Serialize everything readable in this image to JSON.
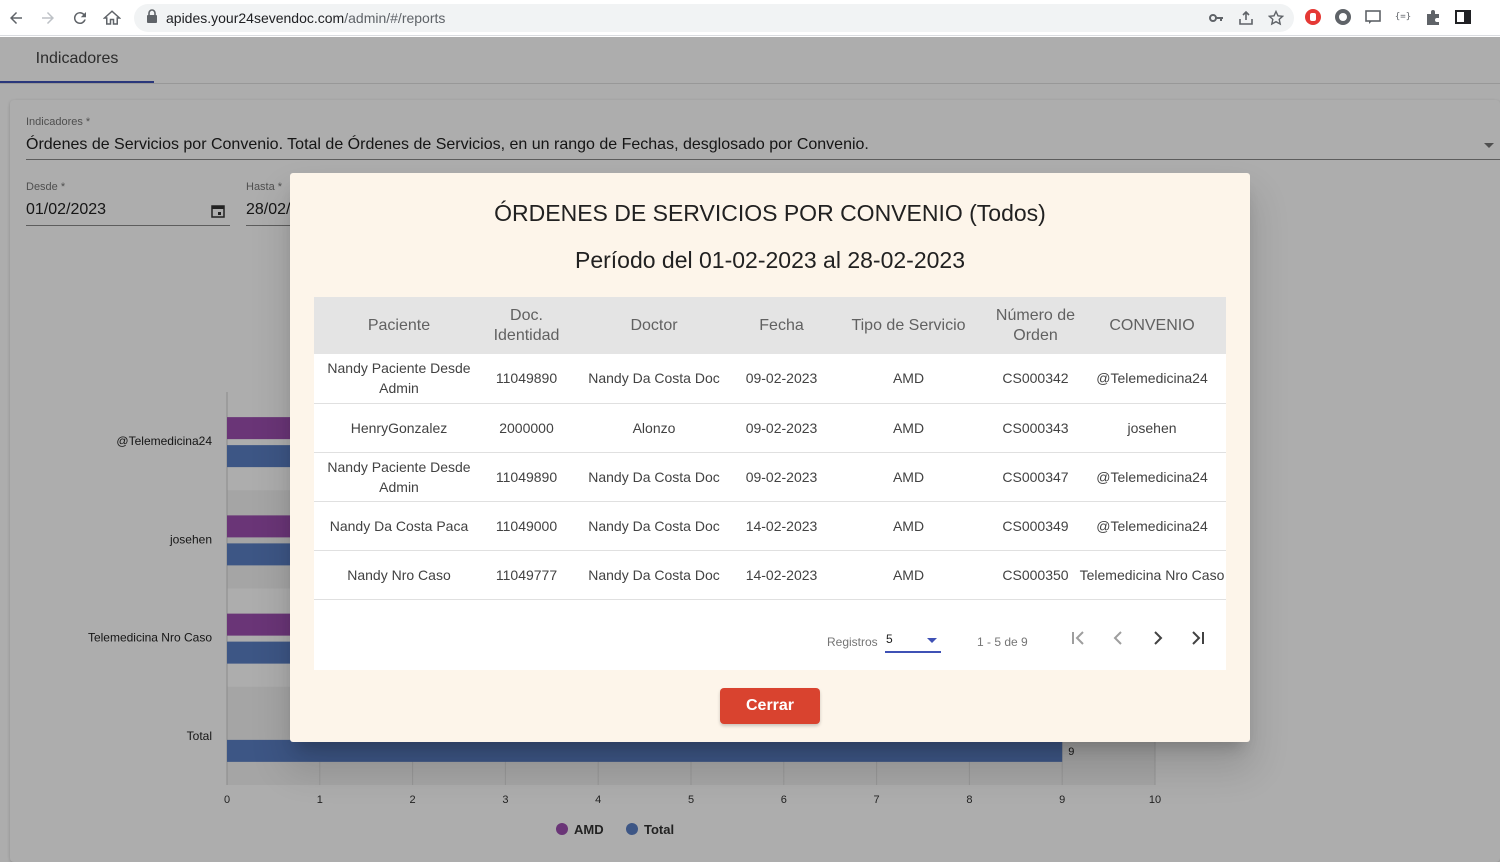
{
  "browser": {
    "url_host": "apides.your24sevendoc.com",
    "url_path": "/admin/#/reports"
  },
  "app": {
    "tab_label": "Indicadores",
    "indicator_label": "Indicadores *",
    "indicator_value": "Órdenes de Servicios por Convenio. Total de Órdenes de Servicios, en un rango de Fechas, desglosado por Convenio.",
    "desde_label": "Desde *",
    "desde_value": "01/02/2023",
    "hasta_label": "Hasta *",
    "hasta_value": "28/02/"
  },
  "chart_data": {
    "type": "bar",
    "orientation": "horizontal",
    "categories": [
      "@Telemedicina24",
      "josehen",
      "Telemedicina Nro Caso",
      "Total"
    ],
    "series": [
      {
        "name": "AMD",
        "color": "#9c4fb0",
        "values": [
          null,
          null,
          null,
          null
        ]
      },
      {
        "name": "Total",
        "color": "#5b7fc4",
        "values": [
          null,
          null,
          null,
          9
        ]
      }
    ],
    "xticks": [
      "0",
      "1",
      "2",
      "3",
      "4",
      "5",
      "6",
      "7",
      "8",
      "9",
      "10"
    ],
    "xlim": [
      0,
      10
    ],
    "value_labels": {
      "Total": "9"
    },
    "legend": "bottom"
  },
  "dialog": {
    "title": "ÓRDENES DE SERVICIOS POR CONVENIO (Todos)",
    "subtitle": "Período del 01-02-2023 al 28-02-2023",
    "columns": [
      "Paciente",
      "Doc. Identidad",
      "Doctor",
      "Fecha",
      "Tipo de Servicio",
      "Número de Orden",
      "CONVENIO"
    ],
    "rows": [
      [
        "Nandy Paciente Desde Admin",
        "11049890",
        "Nandy Da Costa Doc",
        "09-02-2023",
        "AMD",
        "CS000342",
        "@Telemedicina24"
      ],
      [
        "HenryGonzalez",
        "2000000",
        "Alonzo",
        "09-02-2023",
        "AMD",
        "CS000343",
        "josehen"
      ],
      [
        "Nandy Paciente Desde Admin",
        "11049890",
        "Nandy Da Costa Doc",
        "09-02-2023",
        "AMD",
        "CS000347",
        "@Telemedicina24"
      ],
      [
        "Nandy Da Costa Paca",
        "11049000",
        "Nandy Da Costa Doc",
        "14-02-2023",
        "AMD",
        "CS000349",
        "@Telemedicina24"
      ],
      [
        "Nandy Nro Caso",
        "11049777",
        "Nandy Da Costa Doc",
        "14-02-2023",
        "AMD",
        "CS000350",
        "Telemedicina Nro Caso"
      ]
    ],
    "paginator": {
      "label": "Registros",
      "page_size": "5",
      "range": "1 - 5 de 9"
    },
    "close_label": "Cerrar"
  }
}
